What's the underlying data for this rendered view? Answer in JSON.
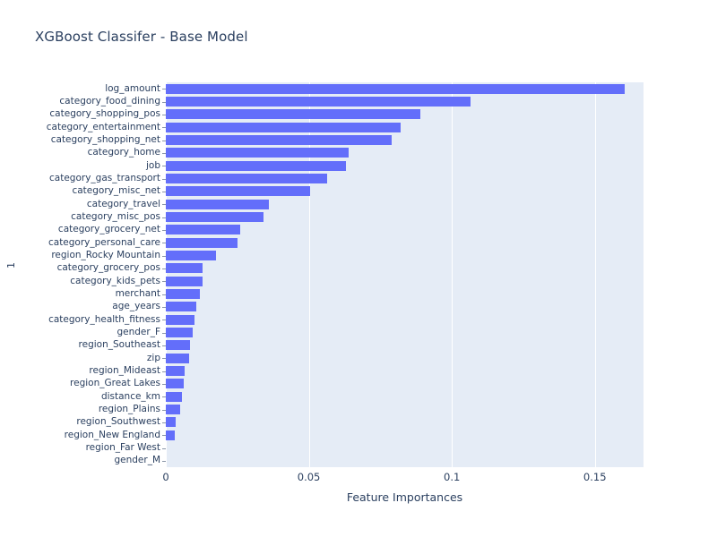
{
  "chart_data": {
    "type": "bar",
    "orientation": "horizontal",
    "title": "XGBoost Classifer - Base Model",
    "xlabel": "Feature Importances",
    "ylabel": "1",
    "xlim": [
      0,
      0.167
    ],
    "xticks": [
      0,
      0.05,
      0.1,
      0.15
    ],
    "xticklabels": [
      "0",
      "0.05",
      "0.1",
      "0.15"
    ],
    "grid": "vertical",
    "legend": "none",
    "bar_color": "#636efa",
    "plot_bgcolor": "#e5ecf6",
    "paper_bgcolor": "#ffffff",
    "text_color": "#2a3f5f",
    "categories": [
      "log_amount",
      "category_food_dining",
      "category_shopping_pos",
      "category_entertainment",
      "category_shopping_net",
      "category_home",
      "job",
      "category_gas_transport",
      "category_misc_net",
      "category_travel",
      "category_misc_pos",
      "category_grocery_net",
      "category_personal_care",
      "region_Rocky Mountain",
      "category_grocery_pos",
      "category_kids_pets",
      "merchant",
      "age_years",
      "category_health_fitness",
      "gender_F",
      "region_Southeast",
      "zip",
      "region_Mideast",
      "region_Great Lakes",
      "distance_km",
      "region_Plains",
      "region_Southwest",
      "region_New England",
      "region_Far West",
      "gender_M"
    ],
    "values": [
      0.1605,
      0.1065,
      0.089,
      0.082,
      0.079,
      0.064,
      0.063,
      0.0565,
      0.0505,
      0.036,
      0.034,
      0.026,
      0.025,
      0.0175,
      0.013,
      0.0128,
      0.0118,
      0.0105,
      0.01,
      0.0095,
      0.0086,
      0.0082,
      0.0066,
      0.0062,
      0.0056,
      0.005,
      0.0035,
      0.0032,
      0.0,
      0.0
    ]
  }
}
